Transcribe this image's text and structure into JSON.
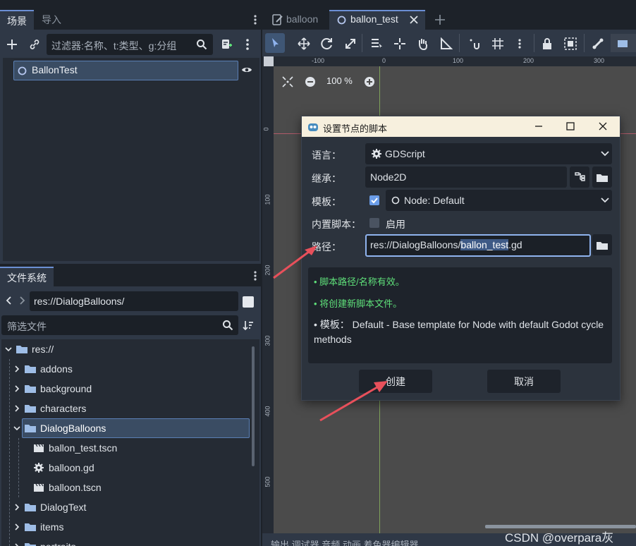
{
  "left_dock": {
    "tabs": [
      "场景",
      "导入"
    ],
    "filter_placeholder": "过滤器:名称、t:类型、g:分组",
    "scene_root": "BallonTest"
  },
  "filesystem": {
    "tab": "文件系统",
    "path": "res://DialogBalloons/",
    "filter_placeholder": "筛选文件",
    "items": [
      {
        "label": "res://",
        "type": "folder",
        "depth": 0,
        "expanded": true
      },
      {
        "label": "addons",
        "type": "folder",
        "depth": 1
      },
      {
        "label": "background",
        "type": "folder",
        "depth": 1
      },
      {
        "label": "characters",
        "type": "folder",
        "depth": 1
      },
      {
        "label": "DialogBalloons",
        "type": "folder",
        "depth": 1,
        "expanded": true,
        "selected": true
      },
      {
        "label": "ballon_test.tscn",
        "type": "scene",
        "depth": 2
      },
      {
        "label": "balloon.gd",
        "type": "script",
        "depth": 2
      },
      {
        "label": "balloon.tscn",
        "type": "scene",
        "depth": 2
      },
      {
        "label": "DialogText",
        "type": "folder",
        "depth": 1
      },
      {
        "label": "items",
        "type": "folder",
        "depth": 1
      },
      {
        "label": "portraits",
        "type": "folder",
        "depth": 1
      }
    ]
  },
  "editor_tabs": [
    {
      "label": "balloon",
      "active": false
    },
    {
      "label": "ballon_test",
      "active": true
    }
  ],
  "viewport": {
    "zoom": "100 %",
    "ruler_top": [
      "-100",
      "0",
      "100",
      "200",
      "300"
    ],
    "ruler_left": [
      "0",
      "100",
      "200",
      "300",
      "400",
      "500"
    ]
  },
  "dialog": {
    "title": "设置节点的脚本",
    "language_label": "语言：",
    "language_value": "GDScript",
    "inherits_label": "继承：",
    "inherits_value": "Node2D",
    "template_label": "模板：",
    "template_checked": true,
    "template_value": "Node: Default",
    "builtin_label": "内置脚本：",
    "builtin_checked": false,
    "builtin_text": "启用",
    "path_label": "路径：",
    "path_prefix": "res://DialogBalloons/",
    "path_selected": "ballon_test",
    "path_suffix": ".gd",
    "messages": [
      "• 脚本路径/名称有效。",
      "• 将创建新脚本文件。"
    ],
    "template_info": "• 模板： Default - Base template for Node with default Godot cycle methods",
    "create_button": "创建",
    "cancel_button": "取消"
  },
  "bottom_partial": "输出  调试器  音频  动画  着色器编辑器",
  "watermark": "CSDN @overpara灰",
  "colors": {
    "accent": "#6b8fd4",
    "arrow": "#e8505b",
    "success": "#5fe07a"
  }
}
